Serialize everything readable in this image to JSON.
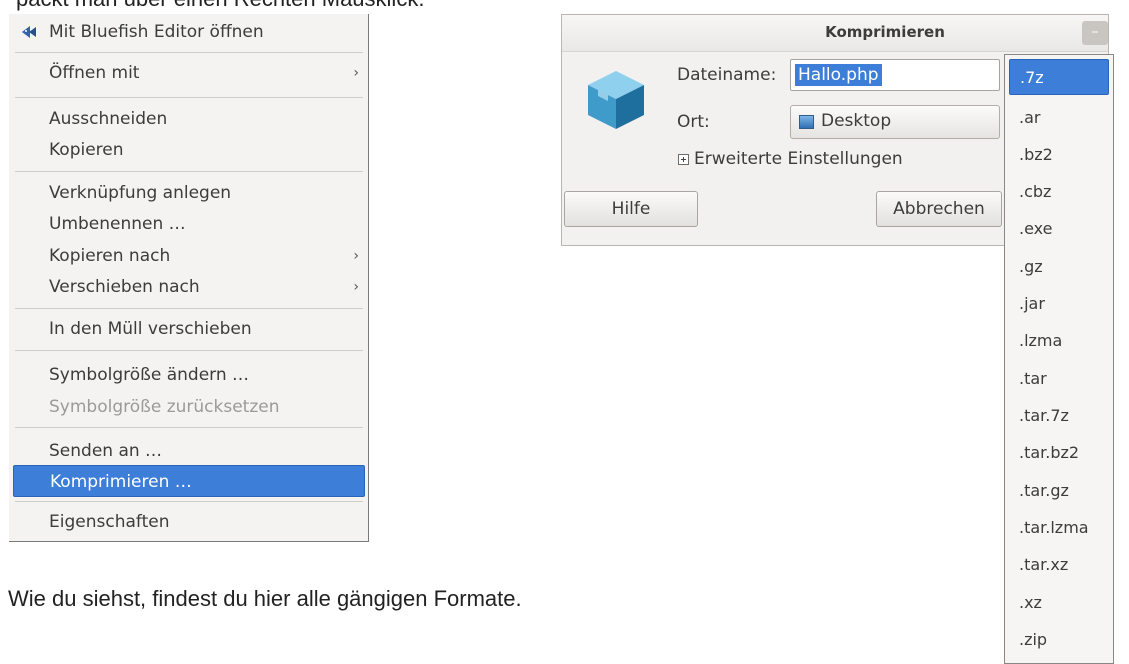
{
  "page": {
    "top_text": "packt man über einen Rechten Mausklick.",
    "bottom_text": "Wie du siehst, findest du hier alle gängigen Formate."
  },
  "context_menu": {
    "items": [
      {
        "label": "Mit Bluefish Editor öffnen",
        "icon": "bluefish-icon"
      },
      {
        "label": "Öffnen mit",
        "submenu": true
      },
      {
        "label": "Ausschneiden"
      },
      {
        "label": "Kopieren"
      },
      {
        "label": "Verknüpfung anlegen"
      },
      {
        "label": "Umbenennen …"
      },
      {
        "label": "Kopieren nach",
        "submenu": true
      },
      {
        "label": "Verschieben nach",
        "submenu": true
      },
      {
        "label": "In den Müll verschieben"
      },
      {
        "label": "Symbolgröße ändern …"
      },
      {
        "label": "Symbolgröße zurücksetzen",
        "disabled": true
      },
      {
        "label": "Senden an …"
      },
      {
        "label": "Komprimieren …",
        "selected": true
      },
      {
        "label": "Eigenschaften"
      }
    ],
    "submenu_arrow": "›"
  },
  "dialog": {
    "title": "Komprimieren",
    "minimize_label": "–",
    "close_label": "×",
    "filename_label": "Dateiname:",
    "filename_value": "Hallo.php",
    "location_label": "Ort:",
    "location_value": "Desktop",
    "advanced_label": "Erweiterte Einstellungen",
    "help_button": "Hilfe",
    "cancel_button": "Abbrechen"
  },
  "format_dropdown": {
    "selected": ".7z",
    "options": [
      ".7z",
      ".ar",
      ".bz2",
      ".cbz",
      ".exe",
      ".gz",
      ".jar",
      ".lzma",
      ".tar",
      ".tar.7z",
      ".tar.bz2",
      ".tar.gz",
      ".tar.lzma",
      ".tar.xz",
      ".xz",
      ".zip"
    ]
  },
  "colors": {
    "selection": "#3d7ed9",
    "menu_bg": "#f4f3f2",
    "dialog_bg": "#f2f1f0"
  }
}
